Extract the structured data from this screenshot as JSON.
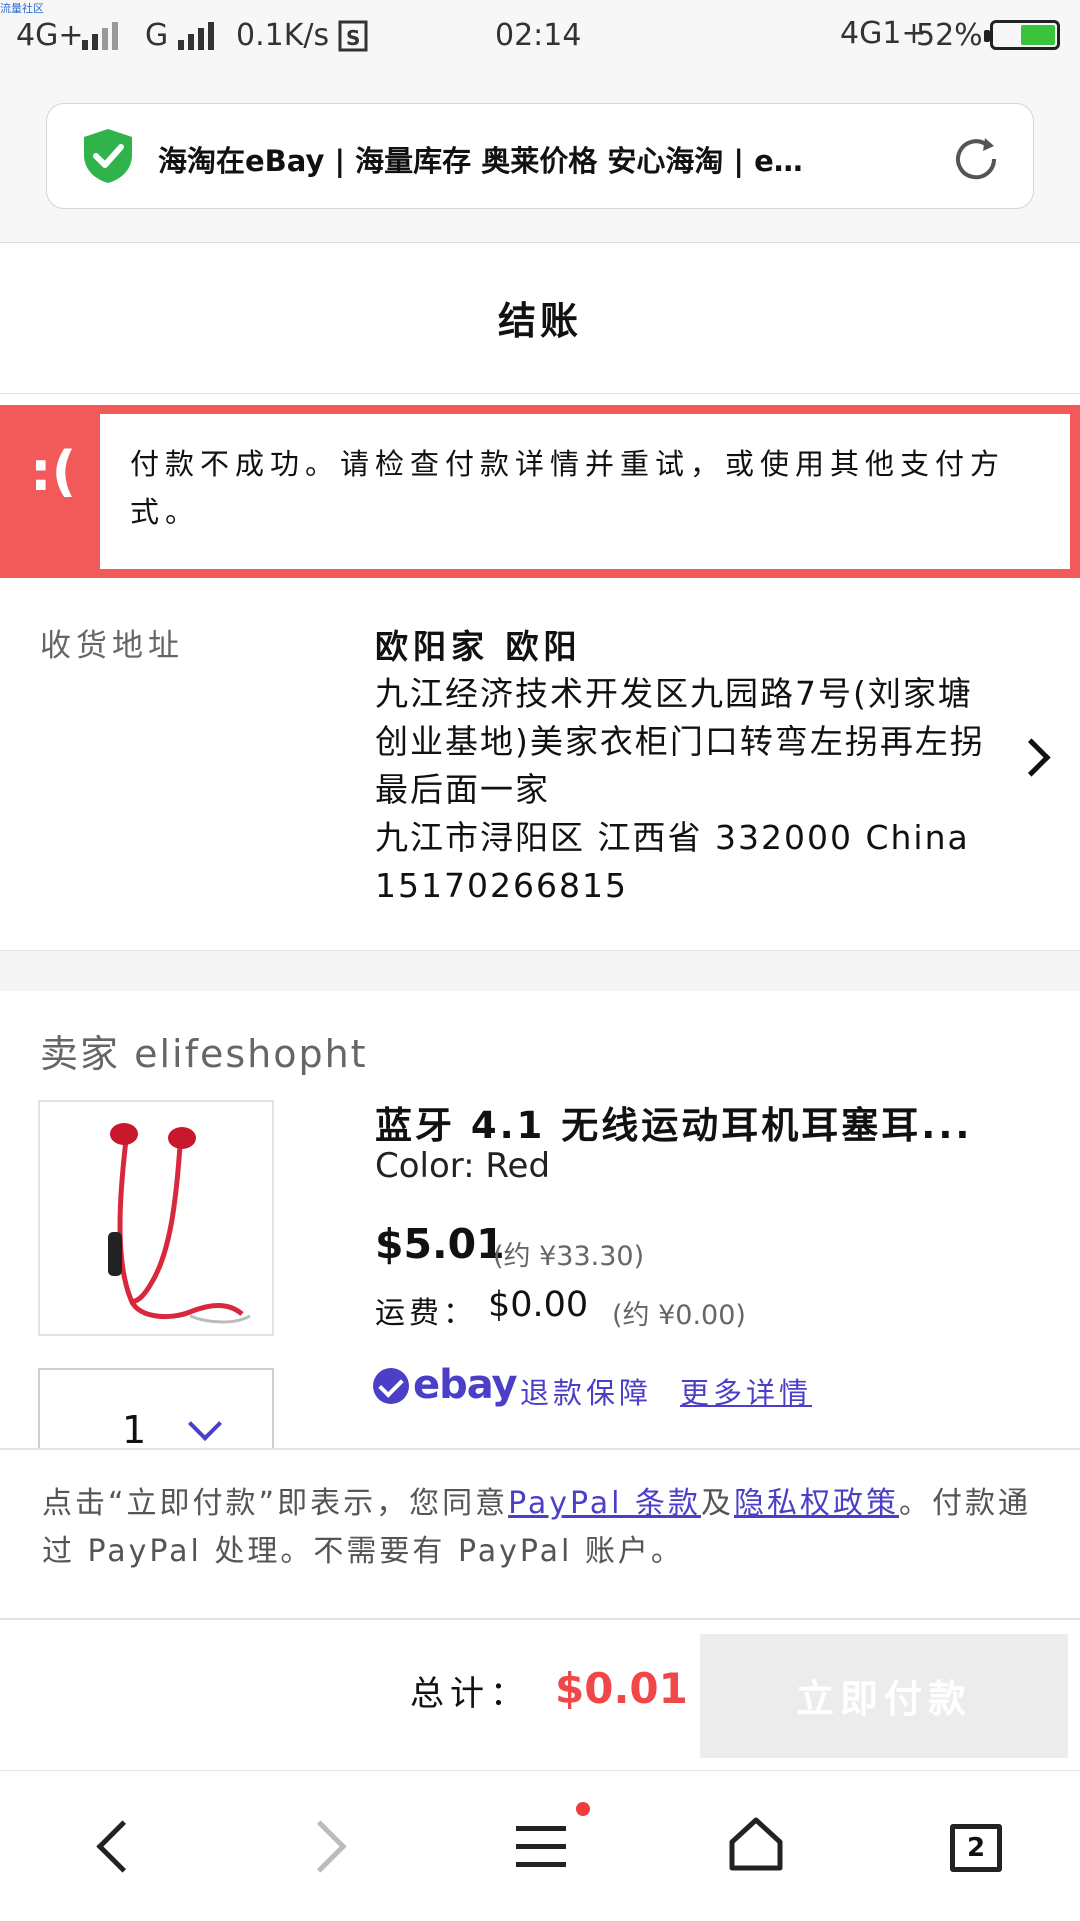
{
  "status_bar": {
    "tag": "流量社区",
    "network_left": "4G+",
    "network_g": "G",
    "speed": "0.1K/s",
    "time": "02:14",
    "network_right": "4G1+",
    "battery": "52%"
  },
  "browser": {
    "url_title": "海淘在eBay | 海量库存 奥莱价格 安心海淘 | e…"
  },
  "page": {
    "title": "结账"
  },
  "error": {
    "face": ":(",
    "message": "付款不成功。请检查付款详情并重试，或使用其他支付方式。"
  },
  "address": {
    "label": "收货地址",
    "name": "欧阳家 欧阳",
    "line1": "九江经济技术开发区九园路7号(刘家塘创业基地)美家衣柜门口转弯左拐再左拐最后面一家",
    "line2": "九江市浔阳区 江西省 332000 China",
    "phone": "15170266815"
  },
  "seller": {
    "label": "卖家 elifeshopht"
  },
  "item": {
    "title": "蓝牙 4.1 无线运动耳机耳塞耳...",
    "color": "Color: Red",
    "price": "$5.01",
    "price_cny": "(约 ¥33.30)",
    "shipping_label": "运费：",
    "shipping": "$0.00",
    "shipping_cny": "(约 ¥0.00)",
    "quantity": "1",
    "guarantee_brand": "ebay",
    "guarantee_text": "退款保障",
    "more_details": "更多详情"
  },
  "notice": {
    "part1": "点击“立即付款”即表示，您同意",
    "link1": "PayPal 条款",
    "part2": "及",
    "link2": "隐私权政策",
    "part3": "。付款通过 PayPal 处理。不需要有 PayPal 账户。"
  },
  "checkout": {
    "total_label": "总计：",
    "total": "$0.01",
    "pay_button": "立即付款"
  },
  "nav": {
    "tab_count": "2"
  },
  "colors": {
    "error_red": "#f25a5a",
    "ebay_purple": "#4b3fc8",
    "total_red": "#f04848"
  }
}
